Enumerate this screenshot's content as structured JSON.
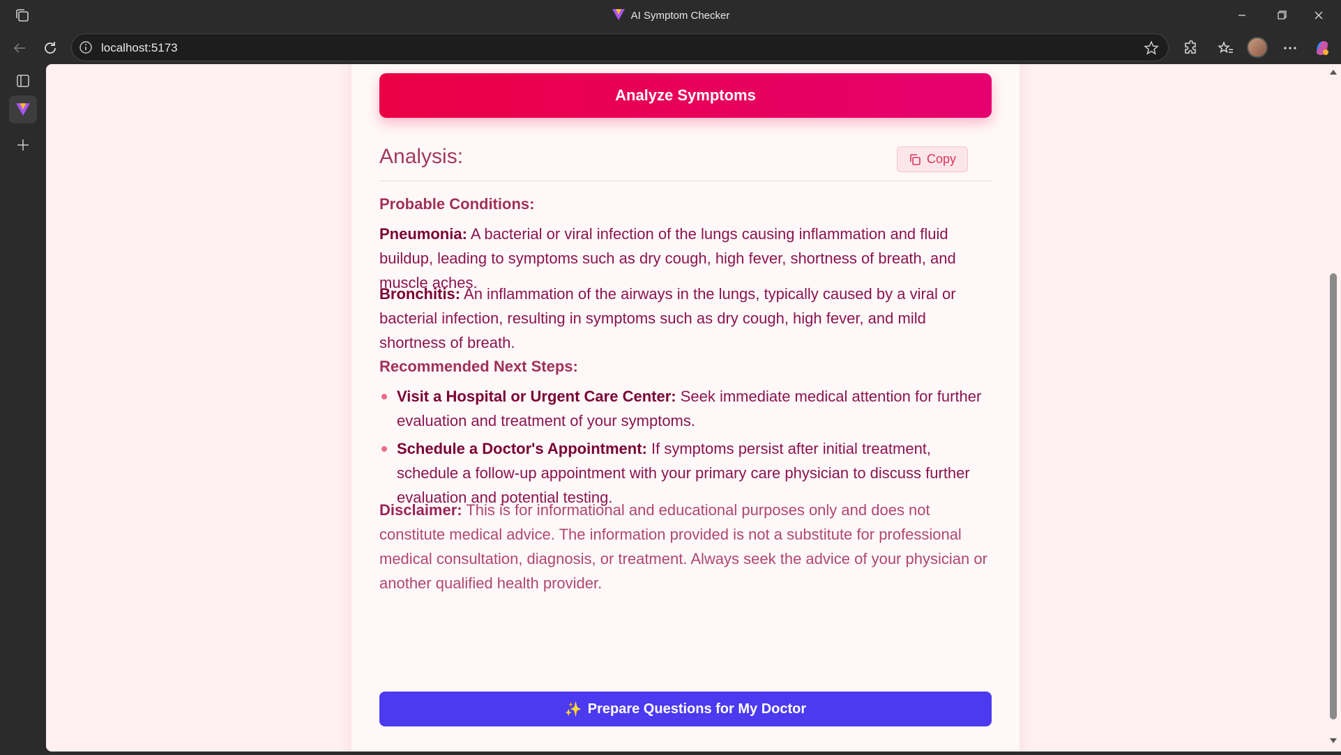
{
  "window": {
    "title": "AI Symptom Checker"
  },
  "toolbar": {
    "url": "localhost:5173"
  },
  "app": {
    "analyze_button": "Analyze Symptoms",
    "analysis_heading": "Analysis:",
    "copy_button": "Copy",
    "probable_title": "Probable Conditions:",
    "conditions": [
      {
        "name": "Pneumonia:",
        "text": "A bacterial or viral infection of the lungs causing inflammation and fluid buildup, leading to symptoms such as dry cough, high fever, shortness of breath, and muscle aches."
      },
      {
        "name": "Bronchitis:",
        "text": "An inflammation of the airways in the lungs, typically caused by a viral or bacterial infection, resulting in symptoms such as dry cough, high fever, and mild shortness of breath."
      }
    ],
    "next_steps_title": "Recommended Next Steps:",
    "steps": [
      {
        "name": "Visit a Hospital or Urgent Care Center:",
        "text": "Seek immediate medical attention for further evaluation and treatment of your symptoms."
      },
      {
        "name": "Schedule a Doctor's Appointment:",
        "text": "If symptoms persist after initial treatment, schedule a follow-up appointment with your primary care physician to discuss further evaluation and potential testing."
      }
    ],
    "disclaimer_label": "Disclaimer:",
    "disclaimer_text": "This is for informational and educational purposes only and does not constitute medical advice. The information provided is not a substitute for professional medical consultation, diagnosis, or treatment. Always seek the advice of your physician or another qualified health provider.",
    "prepare_icon": "✨",
    "prepare_button": "Prepare Questions for My Doctor"
  },
  "colors": {
    "analyze_gradient_start": "#ea0044",
    "analyze_gradient_end": "#e6006f",
    "prepare_button": "#4b3af0",
    "page_background": "#fff0f1"
  }
}
